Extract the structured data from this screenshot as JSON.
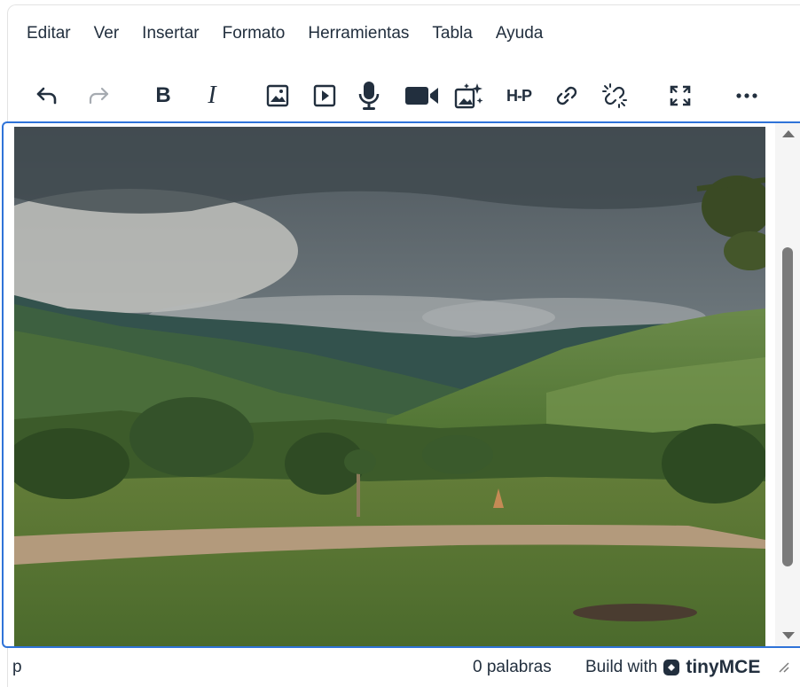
{
  "menubar": {
    "items": [
      "Editar",
      "Ver",
      "Insertar",
      "Formato",
      "Herramientas",
      "Tabla",
      "Ayuda"
    ]
  },
  "toolbar": {
    "buttons": [
      {
        "name": "undo-icon"
      },
      {
        "name": "redo-icon",
        "state": "disabled"
      },
      {
        "name": "bold-icon",
        "glyph": "B"
      },
      {
        "name": "italic-icon",
        "glyph": "I"
      },
      {
        "name": "image-icon"
      },
      {
        "name": "media-icon"
      },
      {
        "name": "microphone-icon"
      },
      {
        "name": "video-camera-icon"
      },
      {
        "name": "ai-image-icon"
      },
      {
        "name": "h5p-icon",
        "glyph": "H-P"
      },
      {
        "name": "link-icon"
      },
      {
        "name": "unlink-icon"
      },
      {
        "name": "fullscreen-icon"
      },
      {
        "name": "more-icon"
      }
    ]
  },
  "content": {
    "image": "landscape photo of green hills and valley under cloudy sky"
  },
  "statusbar": {
    "path": "p",
    "wordcount": "0 palabras",
    "build_with": "Build with",
    "brand": "tinyMCE"
  },
  "colors": {
    "focus_border": "#2f73d8",
    "text": "#222f3e"
  }
}
